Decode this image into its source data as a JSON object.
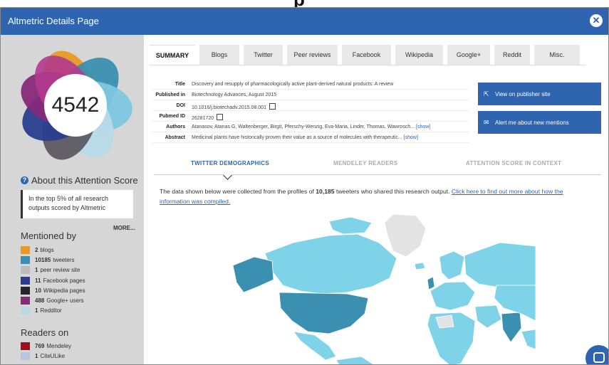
{
  "window": {
    "title": "Altmetric Details Page",
    "close_label": "✕"
  },
  "score": {
    "value": "4542",
    "about_label": "About this Attention Score",
    "context_text": "In the top 5% of all research outputs scored by Altmetric",
    "more_label": "MORE..."
  },
  "mentioned_by": {
    "heading": "Mentioned by",
    "items": [
      {
        "count": "2",
        "label": "blogs",
        "color": "#e89a26"
      },
      {
        "count": "10185",
        "label": "tweeters",
        "color": "#3b8fb0"
      },
      {
        "count": "1",
        "label": "peer review site",
        "color": "#bcbcbc"
      },
      {
        "count": "11",
        "label": "Facebook pages",
        "color": "#2a3e8f"
      },
      {
        "count": "10",
        "label": "Wikipedia pages",
        "color": "#27242e"
      },
      {
        "count": "488",
        "label": "Google+ users",
        "color": "#872a7a"
      },
      {
        "count": "1",
        "label": "Redditor",
        "color": "#b7dae8"
      }
    ]
  },
  "readers_on": {
    "heading": "Readers on",
    "items": [
      {
        "count": "769",
        "label": "Mendeley",
        "color": "#a10f1a"
      },
      {
        "count": "1",
        "label": "CiteULike",
        "color": "#b4c8e6"
      }
    ]
  },
  "tabs": [
    {
      "label": "SUMMARY",
      "active": true
    },
    {
      "label": "Blogs"
    },
    {
      "label": "Twitter"
    },
    {
      "label": "Peer reviews"
    },
    {
      "label": "Facebook"
    },
    {
      "label": "Wikipedia"
    },
    {
      "label": "Google+"
    },
    {
      "label": "Reddit"
    },
    {
      "label": "Misc."
    }
  ],
  "article": {
    "title_key": "Title",
    "title": "Discovery and resupply of pharmacologically active plant-derived natural products: A review",
    "published_key": "Published in",
    "published": "Biotechnology Advances, August 2015",
    "doi_key": "DOI",
    "doi": "10.1016/j.biotechadv.2015.08.001",
    "pubmed_key": "Pubmed ID",
    "pubmed": "26281720",
    "authors_key": "Authors",
    "authors": "Atanasov, Atanas G, Waltenberger, Birgit, Pferschy-Wenzig, Eva-Maria, Linder, Thomas, Wawrosch...",
    "authors_show": "[show]",
    "abstract_key": "Abstract",
    "abstract": "Medicinal plants have historically proven their value as a source of molecules with therapeutic...",
    "abstract_show": "[show]"
  },
  "actions": {
    "publisher_label": "View on publisher site",
    "alert_label": "Alert me about new mentions"
  },
  "subtabs": [
    {
      "label": "TWITTER DEMOGRAPHICS",
      "active": true
    },
    {
      "label": "MENDELEY READERS"
    },
    {
      "label": "ATTENTION SCORE IN CONTEXT"
    }
  ],
  "description": {
    "prefix": "The data shown below were collected from the profiles of ",
    "count": "10,185",
    "suffix": " tweeters who shared this research output. ",
    "link": "Click here to find out more about how the information was compiled."
  },
  "colors": {
    "brand_blue": "#2f64b0",
    "sidebar_bg": "#d6d6d6",
    "map_dark": "#3b8fb0",
    "map_light": "#7fd3e8",
    "map_none": "#e3e3e3"
  }
}
